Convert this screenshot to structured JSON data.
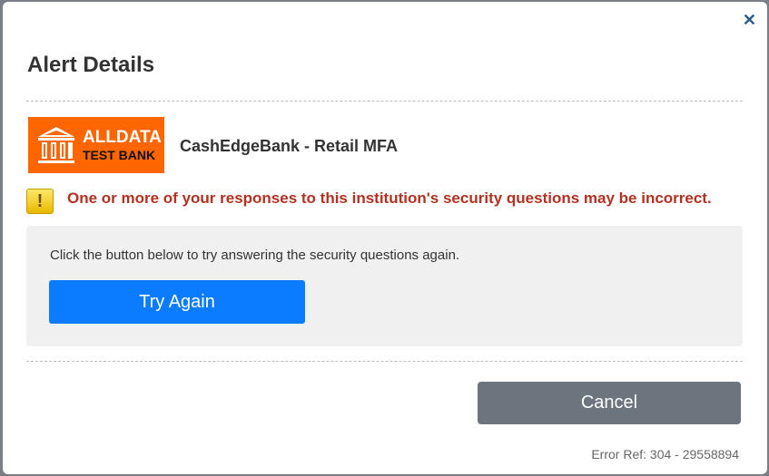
{
  "dialog": {
    "title": "Alert Details",
    "close_icon": "close-icon"
  },
  "logo": {
    "line1": "ALLDATA",
    "line2": "TEST BANK"
  },
  "institution": "CashEdgeBank - Retail MFA",
  "warning": "One or more of your responses to this institution's security questions may be incorrect.",
  "instructions": "Click the button below to try answering the security questions again.",
  "buttons": {
    "try_again": "Try Again",
    "cancel": "Cancel"
  },
  "error_ref": "Error Ref: 304 - 29558894",
  "colors": {
    "primary": "#0b7bff",
    "warning_text": "#b23121",
    "logo_bg": "#ff6600"
  }
}
